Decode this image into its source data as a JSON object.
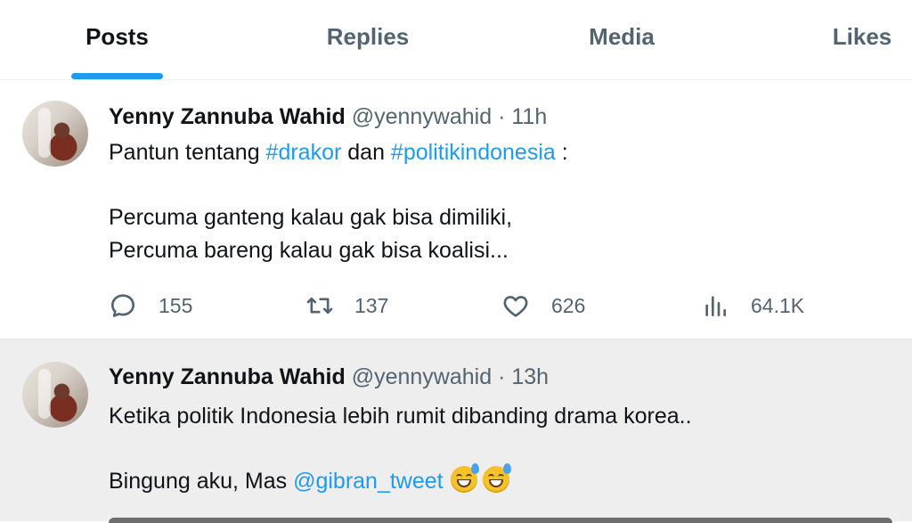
{
  "tabs": [
    {
      "label": "Posts",
      "active": true
    },
    {
      "label": "Replies",
      "active": false
    },
    {
      "label": "Media",
      "active": false
    },
    {
      "label": "Likes",
      "active": false
    }
  ],
  "tweets": [
    {
      "author_name": "Yenny Zannuba Wahid",
      "handle": "@yennywahid",
      "separator": "·",
      "time": "11h",
      "line1_prefix": "Pantun tentang ",
      "hashtag1": "#drakor",
      "line1_mid": " dan ",
      "hashtag2": "#politikindonesia",
      "line1_suffix": " :",
      "line2": "Percuma ganteng kalau gak bisa dimiliki,",
      "line3": "Percuma bareng kalau gak bisa koalisi...",
      "replies": "155",
      "retweets": "137",
      "likes": "626",
      "views": "64.1K"
    },
    {
      "author_name": "Yenny Zannuba Wahid",
      "handle": "@yennywahid",
      "separator": "·",
      "time": "13h",
      "line1": "Ketika politik Indonesia lebih rumit dibanding drama korea..",
      "line2_prefix": "Bingung aku, Mas ",
      "mention": "@gibran_tweet",
      "emoji_name": "grinning-face-with-sweat"
    }
  ],
  "icons": [
    "reply-icon",
    "retweet-icon",
    "like-icon",
    "views-icon"
  ],
  "colors": {
    "accent": "#1d9bf0",
    "text_primary": "#0f1419",
    "text_secondary": "#536471",
    "highlight_background": "#eeeeee"
  }
}
